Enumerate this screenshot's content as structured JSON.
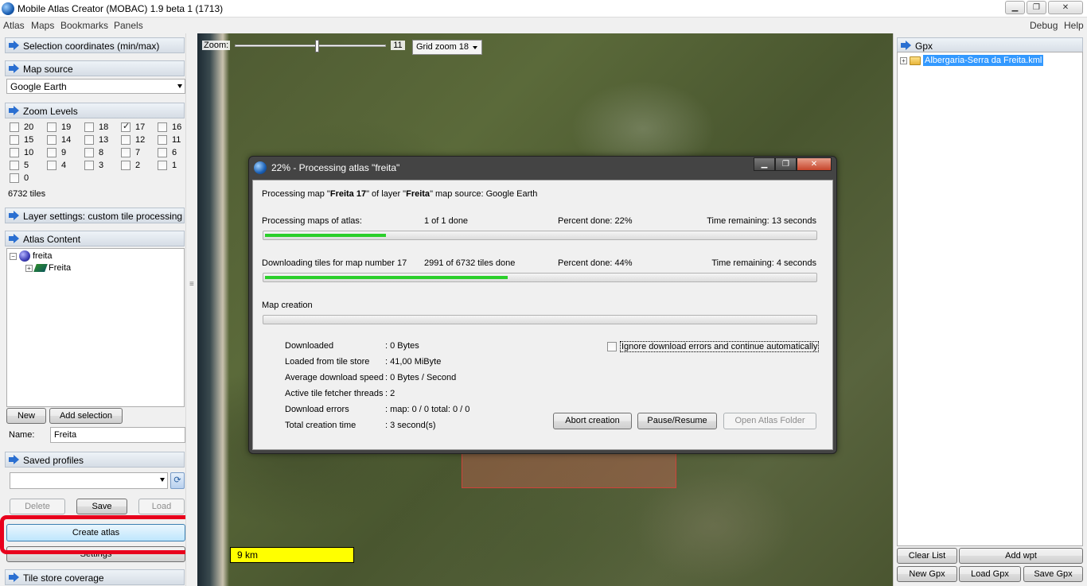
{
  "window": {
    "title": "Mobile Atlas Creator (MOBAC) 1.9 beta 1 (1713)",
    "minimize": "▁",
    "maximize": "❐",
    "close": "✕"
  },
  "menubar": {
    "left": [
      "Atlas",
      "Maps",
      "Bookmarks",
      "Panels"
    ],
    "right": [
      "Debug",
      "Help"
    ]
  },
  "left": {
    "selection_header": "Selection coordinates (min/max)",
    "map_source_header": "Map source",
    "map_source_value": "Google Earth",
    "zoom_header": "Zoom Levels",
    "zoom_levels": [
      {
        "label": "20",
        "checked": false
      },
      {
        "label": "19",
        "checked": false
      },
      {
        "label": "18",
        "checked": false
      },
      {
        "label": "17",
        "checked": true
      },
      {
        "label": "16",
        "checked": false
      },
      {
        "label": "15",
        "checked": false
      },
      {
        "label": "14",
        "checked": false
      },
      {
        "label": "13",
        "checked": false
      },
      {
        "label": "12",
        "checked": false
      },
      {
        "label": "11",
        "checked": false
      },
      {
        "label": "10",
        "checked": false
      },
      {
        "label": "9",
        "checked": false
      },
      {
        "label": "8",
        "checked": false
      },
      {
        "label": "7",
        "checked": false
      },
      {
        "label": "6",
        "checked": false
      },
      {
        "label": "5",
        "checked": false
      },
      {
        "label": "4",
        "checked": false
      },
      {
        "label": "3",
        "checked": false
      },
      {
        "label": "2",
        "checked": false
      },
      {
        "label": "1",
        "checked": false
      },
      {
        "label": "0",
        "checked": false
      }
    ],
    "tiles_count": "6732 tiles",
    "layer_settings_header": "Layer settings: custom tile processing",
    "atlas_content_header": "Atlas Content",
    "tree_atlas": "freita",
    "tree_layer": "Freita",
    "new_button": "New",
    "add_selection_button": "Add selection",
    "name_label": "Name:",
    "name_value": "Freita",
    "saved_profiles_header": "Saved profiles",
    "delete_button": "Delete",
    "save_button": "Save",
    "load_button": "Load",
    "create_atlas_button": "Create atlas",
    "settings_button": "Settings",
    "tile_store_header": "Tile store coverage"
  },
  "map": {
    "zoom_label": "Zoom:",
    "zoom_value": "11",
    "zoom_level": 11,
    "grid_zoom": "Grid zoom 18",
    "scale": "9 km"
  },
  "dialog": {
    "title": "22% - Processing atlas \"freita\"",
    "line1_a": "Processing map \"",
    "line1_map": "Freita 17",
    "line1_b": "\" of layer \"",
    "line1_layer": "Freita",
    "line1_c": "\" map source: Google Earth",
    "atlas_label": "Processing maps of atlas:",
    "atlas_done": "1 of 1 done",
    "atlas_percent": "Percent done: 22%",
    "atlas_remaining": "Time remaining: 13 seconds",
    "atlas_progress": 0.22,
    "tiles_label": "Downloading tiles for map number 17",
    "tiles_done": "2991 of 6732 tiles done",
    "tiles_percent": "Percent done: 44%",
    "tiles_remaining": "Time remaining: 4 seconds",
    "tiles_progress": 0.44,
    "map_creation_label": "Map creation",
    "map_creation_progress": 0,
    "stats": [
      {
        "label": "Downloaded",
        "value": ": 0 Bytes"
      },
      {
        "label": "Loaded from tile store",
        "value": ": 41,00 MiByte"
      },
      {
        "label": "Average download speed",
        "value": ": 0 Bytes / Second"
      },
      {
        "label": "Active tile fetcher threads",
        "value": ": 2"
      },
      {
        "label": "Download errors",
        "value": ": map: 0 / 0 total: 0 / 0"
      },
      {
        "label": "Total creation time",
        "value": ": 3 second(s)"
      }
    ],
    "ignore_errors": "Ignore download errors and continue automatically",
    "abort_button": "Abort creation",
    "pause_button": "Pause/Resume",
    "open_folder_button": "Open Atlas Folder"
  },
  "right": {
    "gpx_header": "Gpx",
    "gpx_file": "Albergaria-Serra da Freita.kml",
    "clear_list_button": "Clear List",
    "add_wpt_button": "Add wpt",
    "new_gpx_button": "New Gpx",
    "load_gpx_button": "Load Gpx",
    "save_gpx_button": "Save Gpx"
  }
}
